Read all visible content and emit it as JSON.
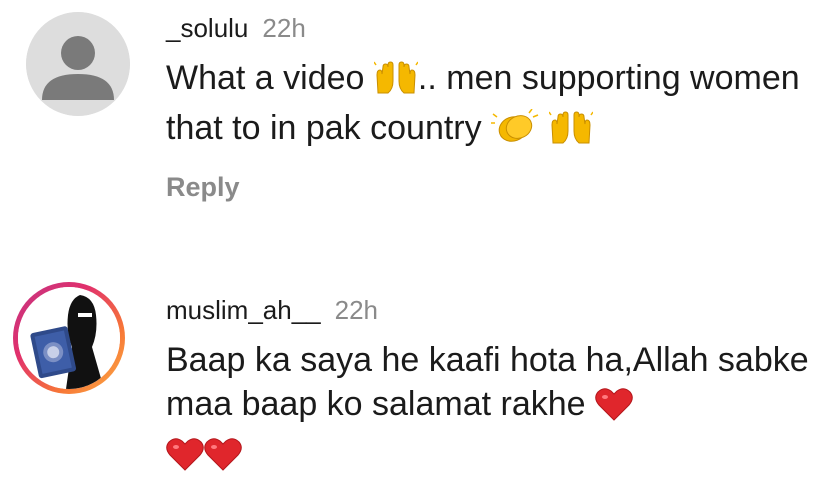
{
  "comments": [
    {
      "username": "_solulu",
      "time": "22h",
      "text_part1": "What a video",
      "text_part2": ".. men supporting women that to in pak country",
      "reply_label": "Reply",
      "emojis": [
        "raising-hands",
        "clapping-hands",
        "raising-hands"
      ]
    },
    {
      "username": "muslim_ah__",
      "time": "22h",
      "text": "Baap ka saya he kaafi hota ha,Allah sabke maa baap ko salamat rakhe",
      "emojis": [
        "red-heart",
        "red-heart",
        "red-heart"
      ]
    }
  ]
}
